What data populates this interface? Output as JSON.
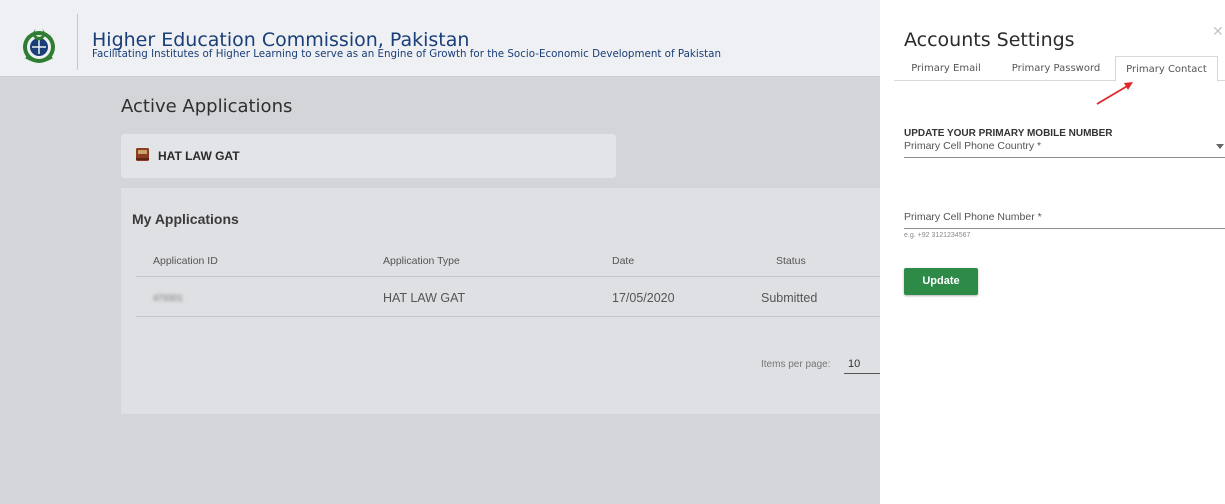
{
  "header": {
    "title": "Higher Education Commission, Pakistan",
    "tagline": "Facilitating Institutes of Higher Learning to serve as an Engine of Growth for the Socio-Economic Development of Pakistan",
    "logo_icon": "hec-logo-icon"
  },
  "main": {
    "active_title": "Active Applications",
    "active_card": {
      "label": "HAT LAW GAT",
      "icon": "book-icon"
    },
    "applications": {
      "title": "My Applications",
      "columns": [
        "Application ID",
        "Application Type",
        "Date",
        "Status"
      ],
      "rows": [
        {
          "id": "479301",
          "type": "HAT LAW GAT",
          "date": "17/05/2020",
          "status": "Submitted"
        }
      ],
      "pager": {
        "label": "Items per page:",
        "value": "10"
      }
    }
  },
  "panel": {
    "title": "Accounts Settings",
    "close_icon": "close-icon",
    "tabs": [
      "Primary Email",
      "Primary Password",
      "Primary Contact"
    ],
    "active_tab": "Primary Contact",
    "heading": "UPDATE YOUR PRIMARY MOBILE NUMBER",
    "country_field": {
      "label": "Primary Cell Phone Country *",
      "value": ""
    },
    "phone_field": {
      "label": "Primary Cell Phone Number *",
      "hint": "e.g. +92 3121234567",
      "value": ""
    },
    "update_button": "Update"
  },
  "colors": {
    "brand_blue": "#1a3e77",
    "update_green": "#2e8b47",
    "arrow_red": "#e0282c"
  }
}
